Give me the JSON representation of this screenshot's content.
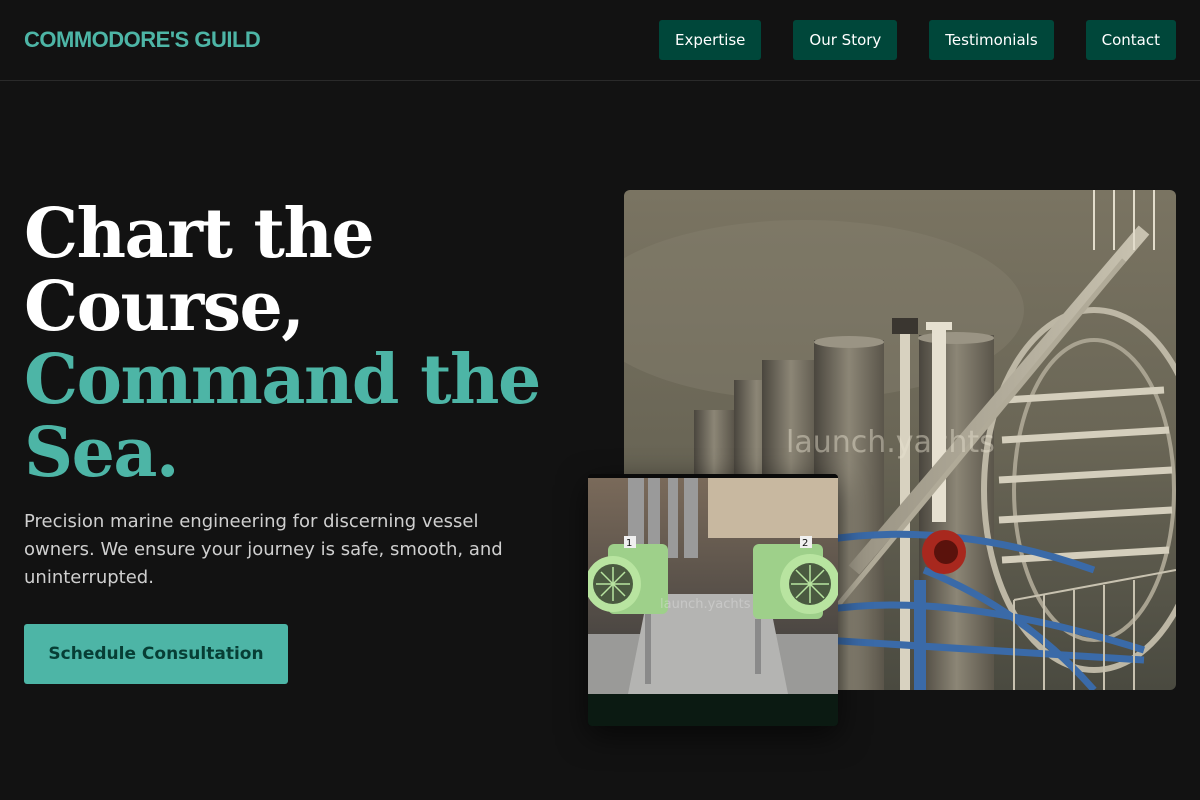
{
  "brand": {
    "name": "COMMODORE'S GUILD"
  },
  "nav": {
    "items": [
      {
        "label": "Expertise"
      },
      {
        "label": "Our Story"
      },
      {
        "label": "Testimonials"
      },
      {
        "label": "Contact"
      }
    ]
  },
  "hero": {
    "title_line1": "Chart the",
    "title_line2": "Course,",
    "title_accent_line1": "Command the",
    "title_accent_line2": "Sea.",
    "subtitle": "Precision marine engineering for discerning vessel owners. We ensure your journey is safe, smooth, and uninterrupted.",
    "cta_label": "Schedule Consultation"
  },
  "images": {
    "main_watermark": "launch.yachts",
    "inset_watermark": "launch.yachts",
    "inset_label_1": "1",
    "inset_label_2": "2"
  },
  "colors": {
    "background": "#121212",
    "accent": "#4db5a6",
    "nav_button": "#00473a",
    "cta_text": "#073e35"
  }
}
